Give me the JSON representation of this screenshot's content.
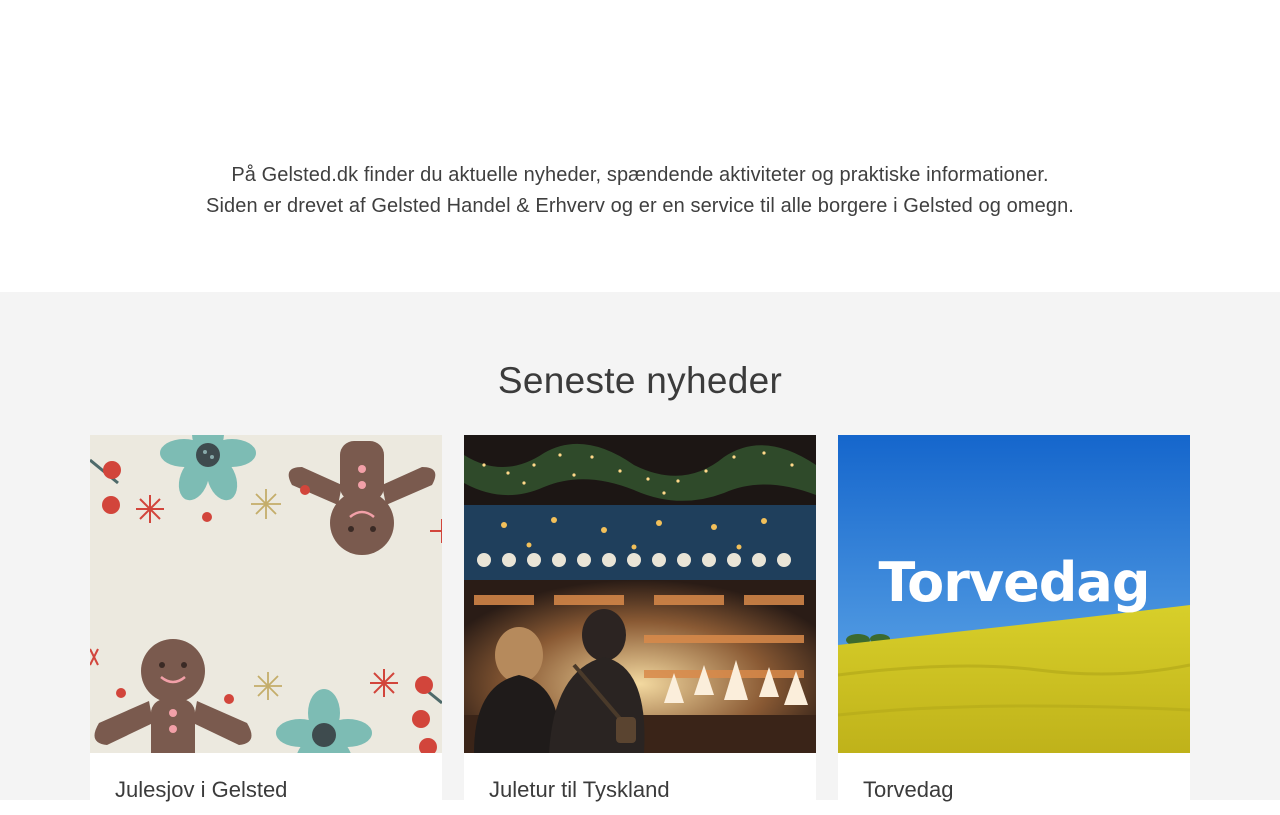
{
  "intro": {
    "line1": "På Gelsted.dk finder du aktuelle nyheder, spændende aktiviteter og praktiske informationer.",
    "line2": "Siden er drevet af Gelsted Handel & Erhverv og er en service til alle borgere i Gelsted og omegn."
  },
  "news": {
    "heading": "Seneste nyheder",
    "cards": [
      {
        "title": "Julesjov i Gelsted"
      },
      {
        "title": "Juletur til Tyskland"
      },
      {
        "title": "Torvedag",
        "image_text": "Torvedag"
      }
    ]
  },
  "colors": {
    "section_bg": "#f4f4f4",
    "gingerbread": "#7a5a4e",
    "berry_red": "#d2453b",
    "flower_teal": "#7dbcb4",
    "sky_blue": "#1f78d6",
    "field_yellow": "#e2d21c"
  }
}
